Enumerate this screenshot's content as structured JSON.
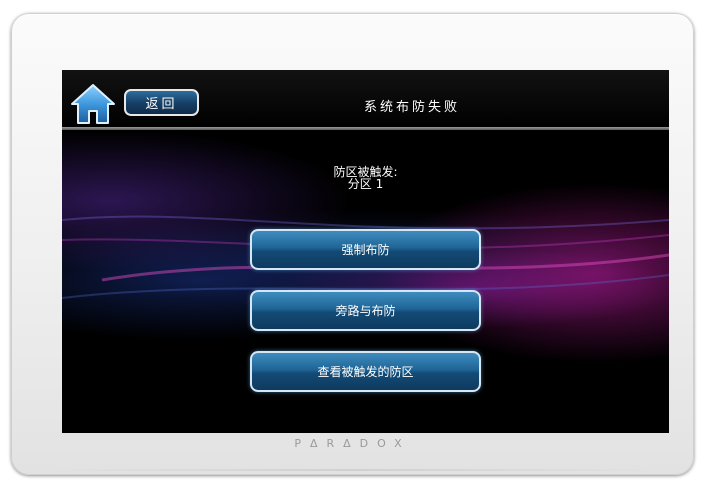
{
  "header": {
    "home_icon": "home-icon",
    "back_label": "返回",
    "title": "系统布防失败"
  },
  "message": {
    "line1": "防区被触发:",
    "line2": "分区 1"
  },
  "actions": [
    {
      "label": "强制布防"
    },
    {
      "label": "旁路与布防"
    },
    {
      "label": "查看被触发的防区"
    }
  ],
  "device": {
    "brand": "PΔRΔDOX"
  },
  "colors": {
    "button_blue": "#1f6596",
    "home_blue": "#4aa3e6",
    "bezel": "#efefef",
    "accent_magenta": "#aa198c"
  }
}
